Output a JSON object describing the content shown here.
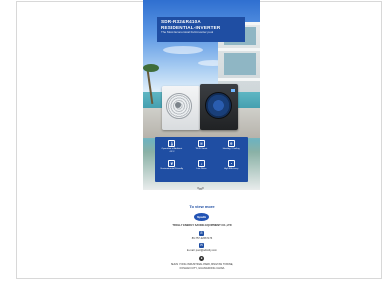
{
  "poster": {
    "model": "SDR-R32&R410A",
    "headline": "RESIDENTIAL-INVERTER",
    "tagline": "The Most Economical Full-Inverter pool"
  },
  "features": [
    {
      "icon": "thermometer-icon",
      "label": "Operation at Ambient -15°C"
    },
    {
      "icon": "wifi-icon",
      "label": "Wi-Fi Smart"
    },
    {
      "icon": "snowflake-icon",
      "label": "Heating / Cooling"
    },
    {
      "icon": "leaf-icon",
      "label": "Environmental Friendly"
    },
    {
      "icon": "speaker-icon",
      "label": "Low Noise"
    },
    {
      "icon": "gauge-icon",
      "label": "High Efficiency"
    }
  ],
  "cta": {
    "view_more": "To view more"
  },
  "footer": {
    "logo_text": "Spolle",
    "company": "TROLLY ENERGY SAVING EQUIPMENT CO.,LTD",
    "phone": "86-757-22667176",
    "email": "E-mail: pool@sdtrolly.com",
    "address_line1": "SHUN YONG INDUSTRIAL PARK,XINGTAN TOWNE,",
    "address_line2": "FOSHAN CITY, GUANGDONG CHINA"
  },
  "colors": {
    "brand_blue": "#1f4ea3"
  }
}
